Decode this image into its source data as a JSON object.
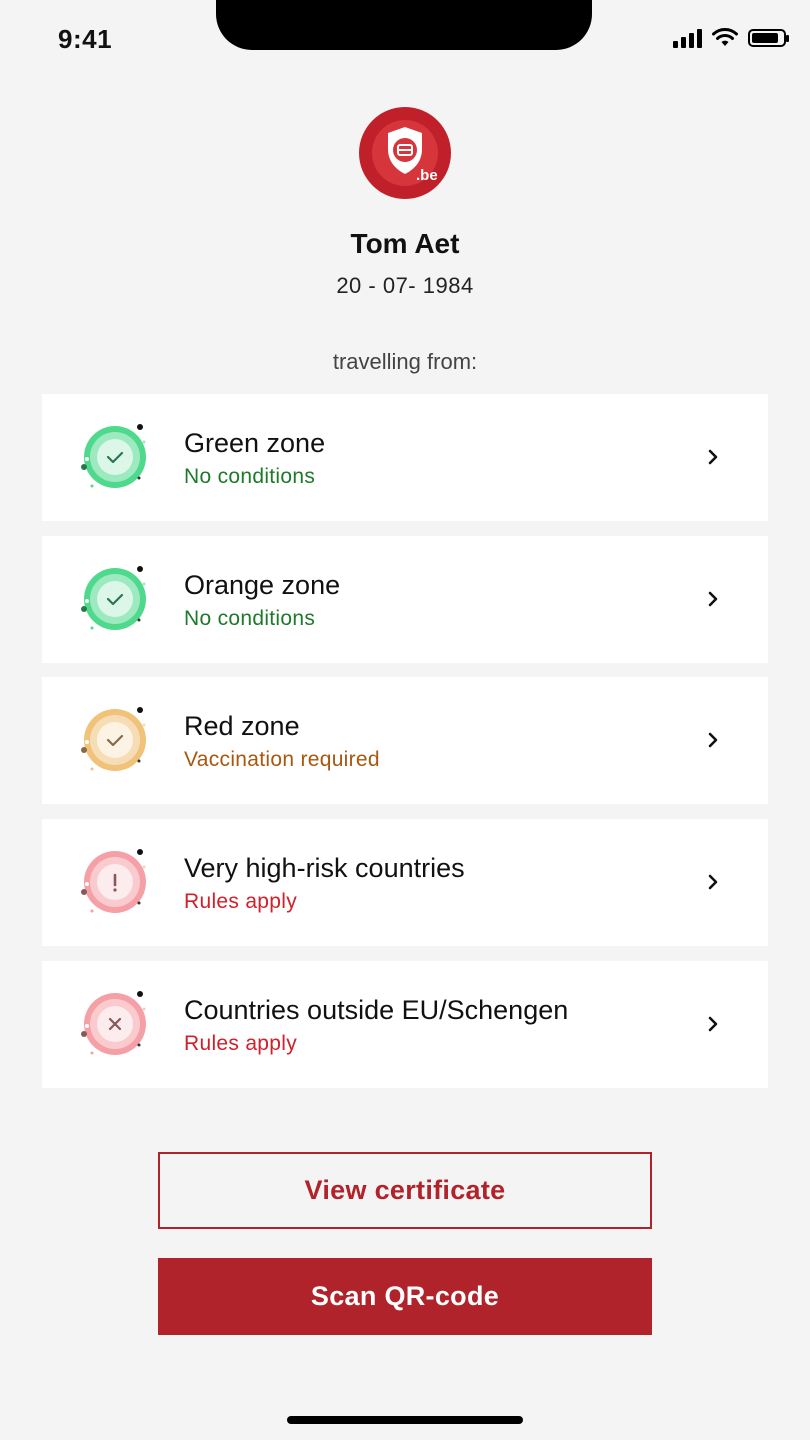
{
  "status_bar": {
    "time": "9:41",
    "battery_level": 0.85
  },
  "profile": {
    "name": "Tom Aet",
    "dob": "20 - 07- 1984",
    "logo_text": ".be"
  },
  "travelling_label": "travelling from:",
  "zones": [
    {
      "title": "Green zone",
      "subtitle": "No conditions",
      "status": "check",
      "icon_color": "#4fd98c",
      "subtitle_color": "#1e7a2a"
    },
    {
      "title": "Orange zone",
      "subtitle": "No conditions",
      "status": "check",
      "icon_color": "#4fd98c",
      "subtitle_color": "#1e7a2a"
    },
    {
      "title": "Red zone",
      "subtitle": "Vaccination required",
      "status": "check",
      "icon_color": "#f0c27a",
      "subtitle_color": "#a8570f"
    },
    {
      "title": "Very high-risk countries",
      "subtitle": "Rules apply",
      "status": "warning",
      "icon_color": "#f5a0a6",
      "subtitle_color": "#d0202a"
    },
    {
      "title": "Countries outside EU/Schengen",
      "subtitle": "Rules apply",
      "status": "cross",
      "icon_color": "#f5a0a6",
      "subtitle_color": "#d0202a"
    }
  ],
  "buttons": {
    "view_certificate": "View certificate",
    "scan_qr": "Scan QR-code"
  },
  "colors": {
    "brand_red": "#b0232a",
    "background": "#f4f4f4"
  }
}
